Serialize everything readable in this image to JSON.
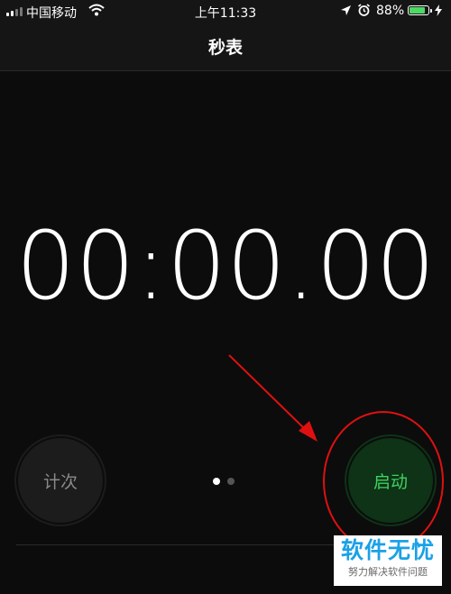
{
  "status_bar": {
    "carrier": "中国移动",
    "time": "上午11:33",
    "battery_percent": "88%"
  },
  "nav": {
    "title": "秒表"
  },
  "timer": {
    "display": "00:00.00"
  },
  "controls": {
    "lap_label": "计次",
    "start_label": "启动",
    "page_count": 2,
    "active_page": 1
  },
  "colors": {
    "start_text": "#3fd15f",
    "start_bg": "#0e3317",
    "lap_text": "#8a8a8a",
    "annotation": "#e01010",
    "watermark_title": "#1aa1e6"
  },
  "watermark": {
    "title": "软件无忧",
    "subtitle": "努力解决软件问题"
  }
}
